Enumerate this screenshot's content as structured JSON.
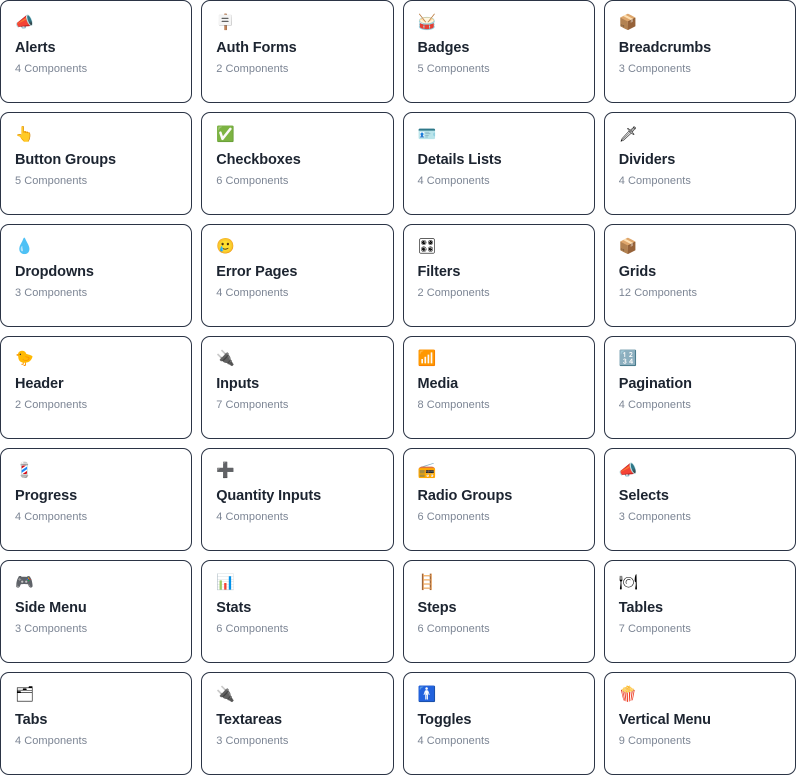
{
  "page": {
    "title": "Component Library",
    "layout": "grid",
    "columns": 4,
    "count_suffix": "Components",
    "colors": {
      "card_border": "#2b3445",
      "card_background": "#ffffff",
      "title_text": "#1c2430",
      "count_text": "#7c8594",
      "page_background": "#ffffff"
    }
  },
  "cards": [
    {
      "icon": "📣",
      "icon_name": "megaphone-icon",
      "title": "Alerts",
      "count": "4 Components"
    },
    {
      "icon": "🪧",
      "icon_name": "placard-icon",
      "title": "Auth Forms",
      "count": "2 Components"
    },
    {
      "icon": "🥁",
      "icon_name": "drum-icon",
      "title": "Badges",
      "count": "5 Components"
    },
    {
      "icon": "📦",
      "icon_name": "package-icon",
      "title": "Breadcrumbs",
      "count": "3 Components"
    },
    {
      "icon": "👆",
      "icon_name": "pointing-up-hand-icon",
      "title": "Button Groups",
      "count": "5 Components"
    },
    {
      "icon": "✅",
      "icon_name": "check-mark-button-icon",
      "title": "Checkboxes",
      "count": "6 Components"
    },
    {
      "icon": "🪪",
      "icon_name": "identification-card-icon",
      "title": "Details Lists",
      "count": "4 Components"
    },
    {
      "icon": "🗡",
      "icon_name": "dagger-icon",
      "title": "Dividers",
      "count": "4 Components"
    },
    {
      "icon": "💧",
      "icon_name": "droplet-icon",
      "title": "Dropdowns",
      "count": "3 Components"
    },
    {
      "icon": "🥲",
      "icon_name": "smiling-face-with-tear-icon",
      "title": "Error Pages",
      "count": "4 Components"
    },
    {
      "icon": "🎛",
      "icon_name": "control-knobs-icon",
      "title": "Filters",
      "count": "2 Components"
    },
    {
      "icon": "📦",
      "icon_name": "package-icon",
      "title": "Grids",
      "count": "12 Components"
    },
    {
      "icon": "🐤",
      "icon_name": "baby-chick-icon",
      "title": "Header",
      "count": "2 Components"
    },
    {
      "icon": "🔌",
      "icon_name": "electric-plug-icon",
      "title": "Inputs",
      "count": "7 Components"
    },
    {
      "icon": "📶",
      "icon_name": "antenna-bars-icon",
      "title": "Media",
      "count": "8 Components"
    },
    {
      "icon": "🔢",
      "icon_name": "input-numbers-icon",
      "title": "Pagination",
      "count": "4 Components"
    },
    {
      "icon": "💈",
      "icon_name": "barber-pole-icon",
      "title": "Progress",
      "count": "4 Components"
    },
    {
      "icon": "➕",
      "icon_name": "plus-icon",
      "title": "Quantity Inputs",
      "count": "4 Components"
    },
    {
      "icon": "📻",
      "icon_name": "radio-icon",
      "title": "Radio Groups",
      "count": "6 Components"
    },
    {
      "icon": "📣",
      "icon_name": "megaphone-icon",
      "title": "Selects",
      "count": "3 Components"
    },
    {
      "icon": "🎮",
      "icon_name": "video-game-controller-icon",
      "title": "Side Menu",
      "count": "3 Components"
    },
    {
      "icon": "📊",
      "icon_name": "bar-chart-icon",
      "title": "Stats",
      "count": "6 Components"
    },
    {
      "icon": "🪜",
      "icon_name": "ladder-icon",
      "title": "Steps",
      "count": "6 Components"
    },
    {
      "icon": "🍽",
      "icon_name": "fork-and-knife-with-plate-icon",
      "title": "Tables",
      "count": "7 Components"
    },
    {
      "icon": "🗂",
      "icon_name": "card-index-dividers-icon",
      "title": "Tabs",
      "count": "4 Components"
    },
    {
      "icon": "🔌",
      "icon_name": "electric-plug-icon",
      "title": "Textareas",
      "count": "3 Components"
    },
    {
      "icon": "🚹",
      "icon_name": "mens-room-icon",
      "title": "Toggles",
      "count": "4 Components"
    },
    {
      "icon": "🍿",
      "icon_name": "popcorn-icon",
      "title": "Vertical Menu",
      "count": "9 Components"
    }
  ]
}
